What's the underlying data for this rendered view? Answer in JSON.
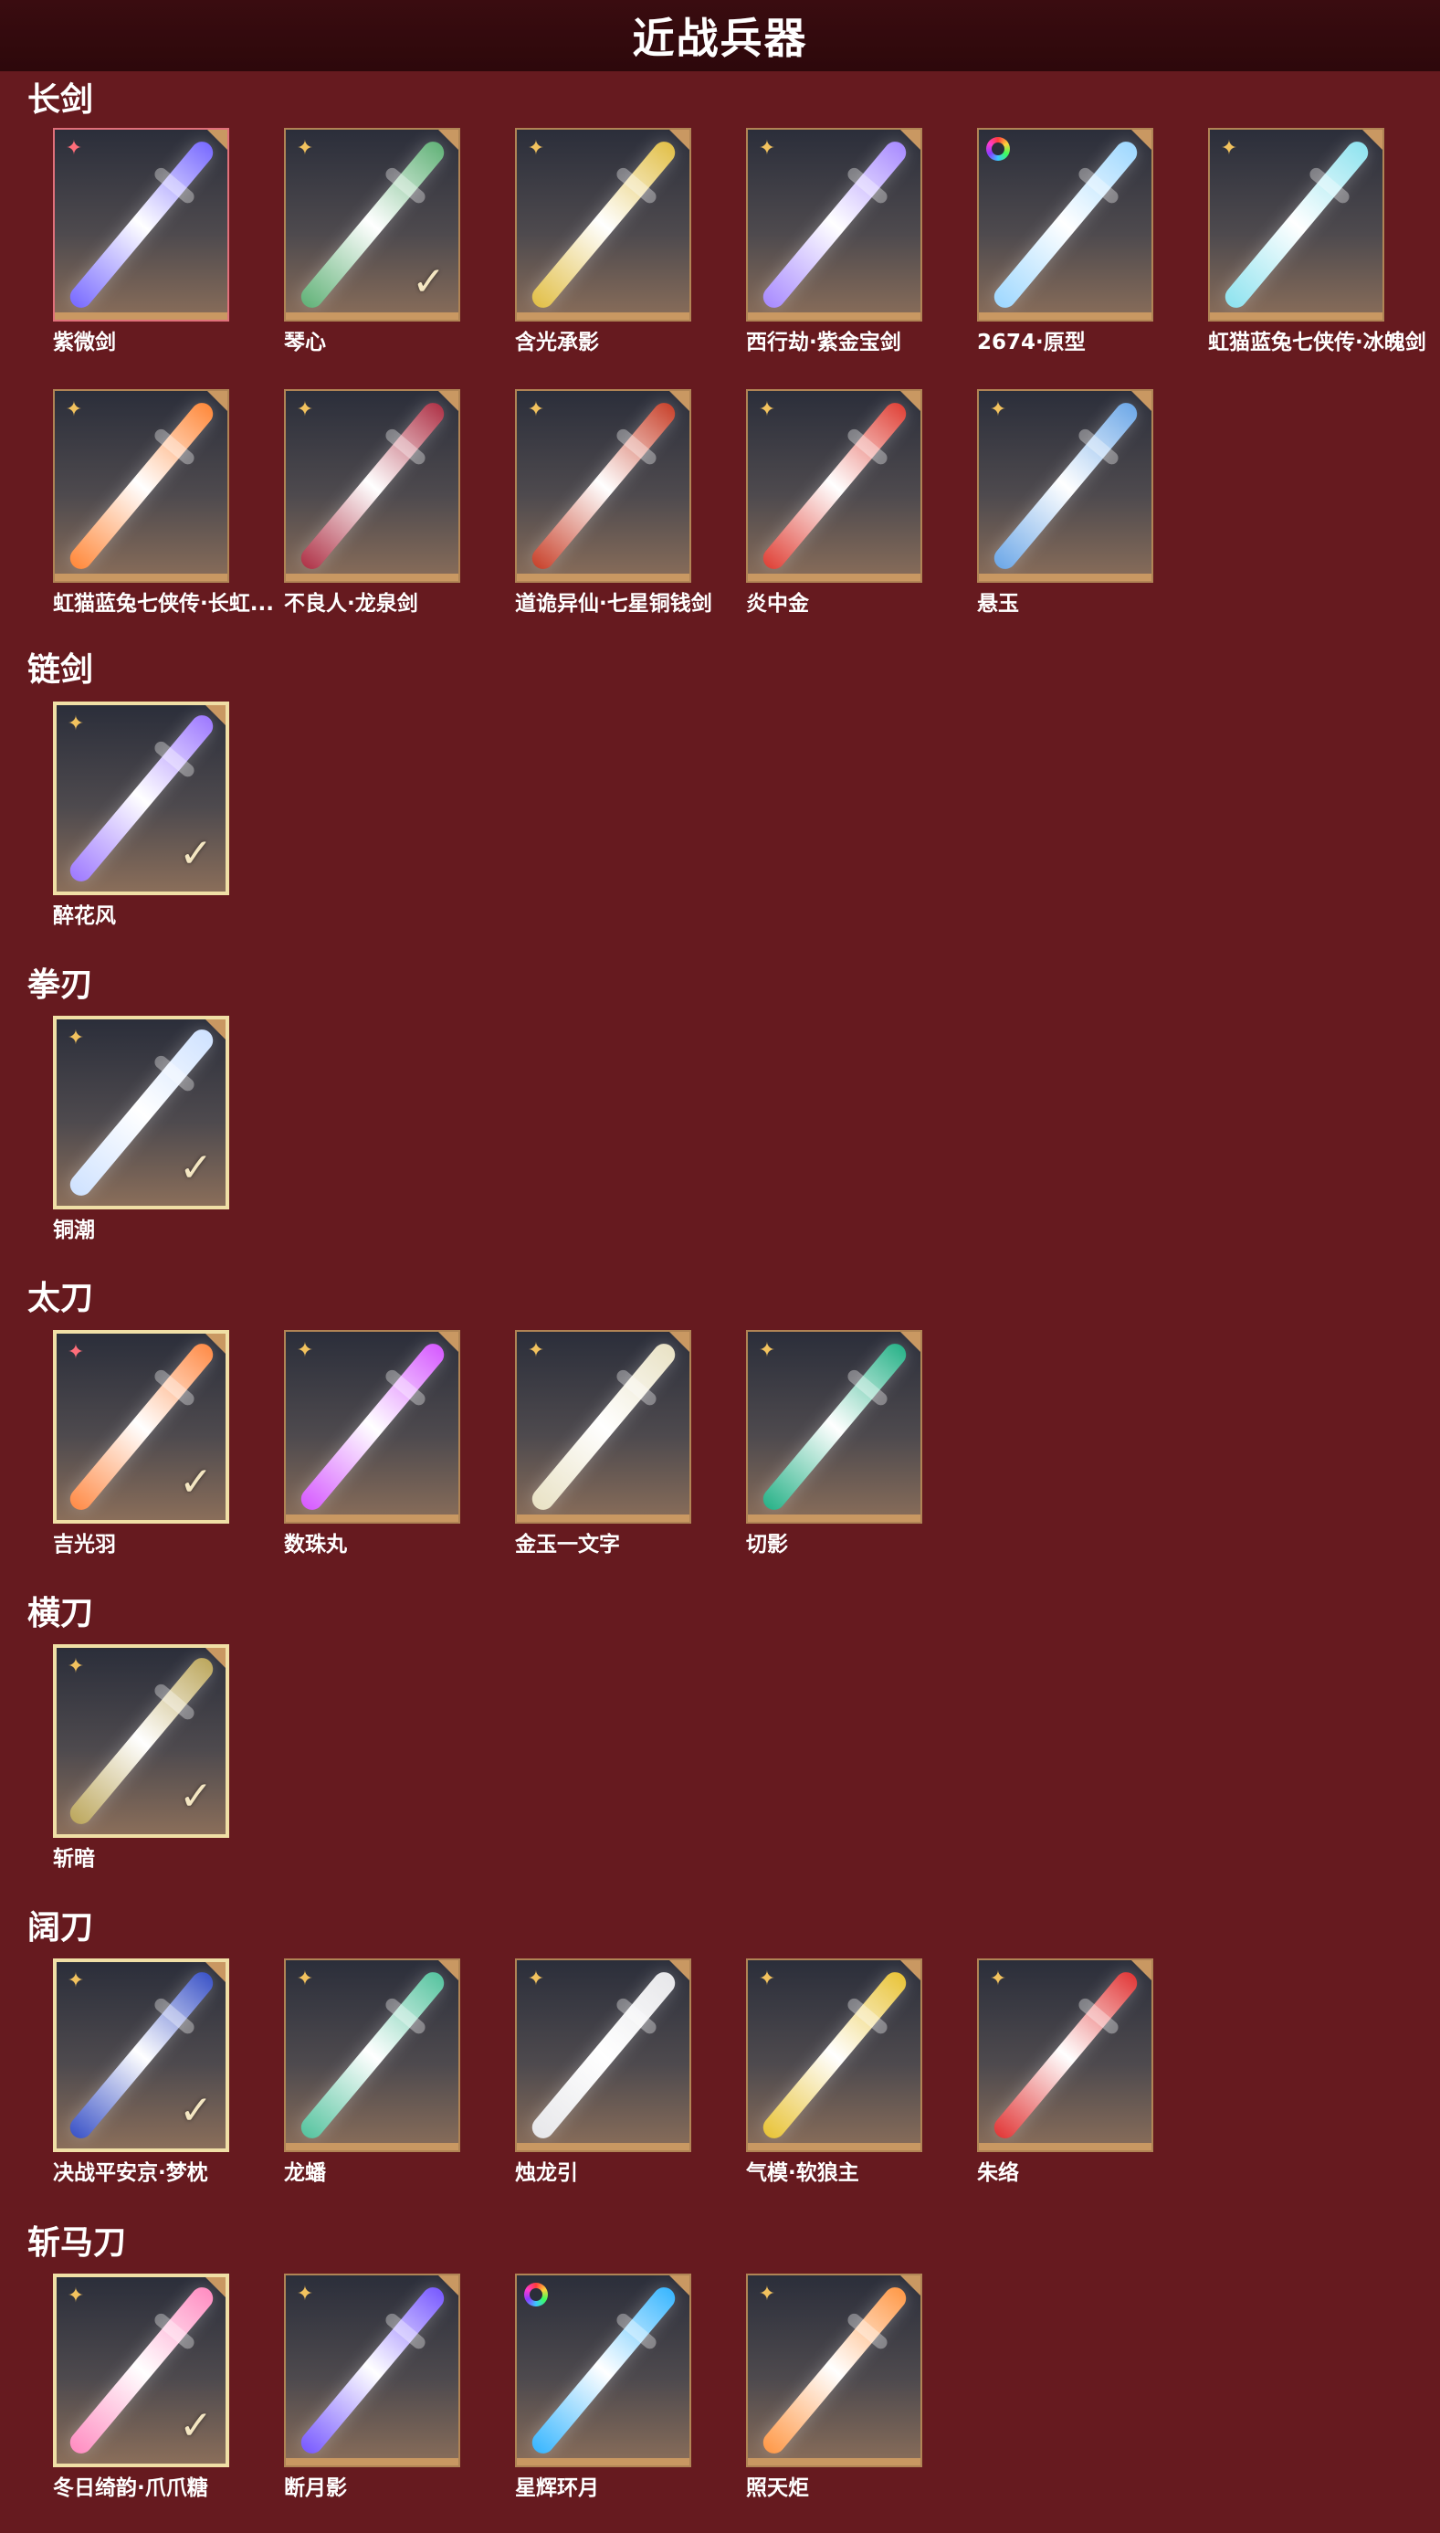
{
  "title": "近战兵器",
  "sections": [
    {
      "title": "长剑",
      "items": [
        {
          "label": "紫微剑",
          "badge": "pink",
          "selected": false,
          "red": true,
          "color": "#7a6cff"
        },
        {
          "label": "琴心",
          "badge": "gold",
          "selected": false,
          "check": true,
          "color": "#64b37a"
        },
        {
          "label": "含光承影",
          "badge": "gold",
          "selected": false,
          "color": "#e2c04a"
        },
        {
          "label": "西行劫·紫金宝剑",
          "badge": "gold",
          "selected": false,
          "color": "#a98cff"
        },
        {
          "label": "2674·原型",
          "badge": "rainbow",
          "selected": false,
          "color": "#9fd8ff"
        },
        {
          "label": "虹猫蓝兔七侠传·冰魄剑",
          "badge": "gold",
          "selected": false,
          "color": "#8fe3ef"
        },
        {
          "label": "虹猫蓝兔七侠传·长虹剑",
          "display": "虹猫蓝兔七侠传·长虹...",
          "badge": "gold",
          "selected": false,
          "color": "#ff8a3d"
        },
        {
          "label": "不良人·龙泉剑",
          "badge": "gold",
          "selected": false,
          "color": "#b0364a"
        },
        {
          "label": "道诡异仙·七星铜钱剑",
          "badge": "gold",
          "selected": false,
          "color": "#c9452f"
        },
        {
          "label": "炎中金",
          "badge": "gold",
          "selected": false,
          "color": "#e0443a"
        },
        {
          "label": "悬玉",
          "badge": "gold",
          "selected": false,
          "color": "#6fa9e8"
        }
      ]
    },
    {
      "title": "链剑",
      "items": [
        {
          "label": "醉花风",
          "badge": "gold",
          "selected": true,
          "color": "#9f7bff"
        }
      ]
    },
    {
      "title": "拳刃",
      "items": [
        {
          "label": "铜潮",
          "badge": "gold",
          "selected": true,
          "color": "#cfe2ff"
        }
      ]
    },
    {
      "title": "太刀",
      "items": [
        {
          "label": "吉光羽",
          "badge": "pink",
          "selected": true,
          "color": "#ff8d4a"
        },
        {
          "label": "数珠丸",
          "badge": "gold",
          "selected": false,
          "color": "#d65cff"
        },
        {
          "label": "金玉一文字",
          "badge": "gold",
          "selected": false,
          "color": "#e9e2c5"
        },
        {
          "label": "切影",
          "badge": "gold",
          "selected": false,
          "color": "#2bb38a"
        }
      ]
    },
    {
      "title": "横刀",
      "items": [
        {
          "label": "斩暗",
          "badge": "gold",
          "selected": true,
          "color": "#bda85f"
        }
      ]
    },
    {
      "title": "阔刀",
      "items": [
        {
          "label": "决战平安京·梦枕",
          "badge": "gold",
          "selected": true,
          "color": "#3e56c8"
        },
        {
          "label": "龙蟠",
          "badge": "gold",
          "selected": false,
          "color": "#58c4a0"
        },
        {
          "label": "烛龙引",
          "badge": "gold",
          "selected": false,
          "color": "#e7e7ea"
        },
        {
          "label": "气模·软狼主",
          "badge": "gold",
          "selected": false,
          "color": "#e9c43a"
        },
        {
          "label": "朱络",
          "badge": "gold",
          "selected": false,
          "color": "#e23a3a"
        }
      ]
    },
    {
      "title": "斩马刀",
      "items": [
        {
          "label": "冬日绮韵·爪爪糖",
          "badge": "gold",
          "selected": true,
          "color": "#ff8ec2"
        },
        {
          "label": "断月影",
          "badge": "gold",
          "selected": false,
          "color": "#7a5cff"
        },
        {
          "label": "星辉环月",
          "badge": "rainbow",
          "selected": false,
          "color": "#3bb7ff"
        },
        {
          "label": "照天炬",
          "badge": "gold",
          "selected": false,
          "color": "#ff9a4a"
        }
      ]
    }
  ]
}
